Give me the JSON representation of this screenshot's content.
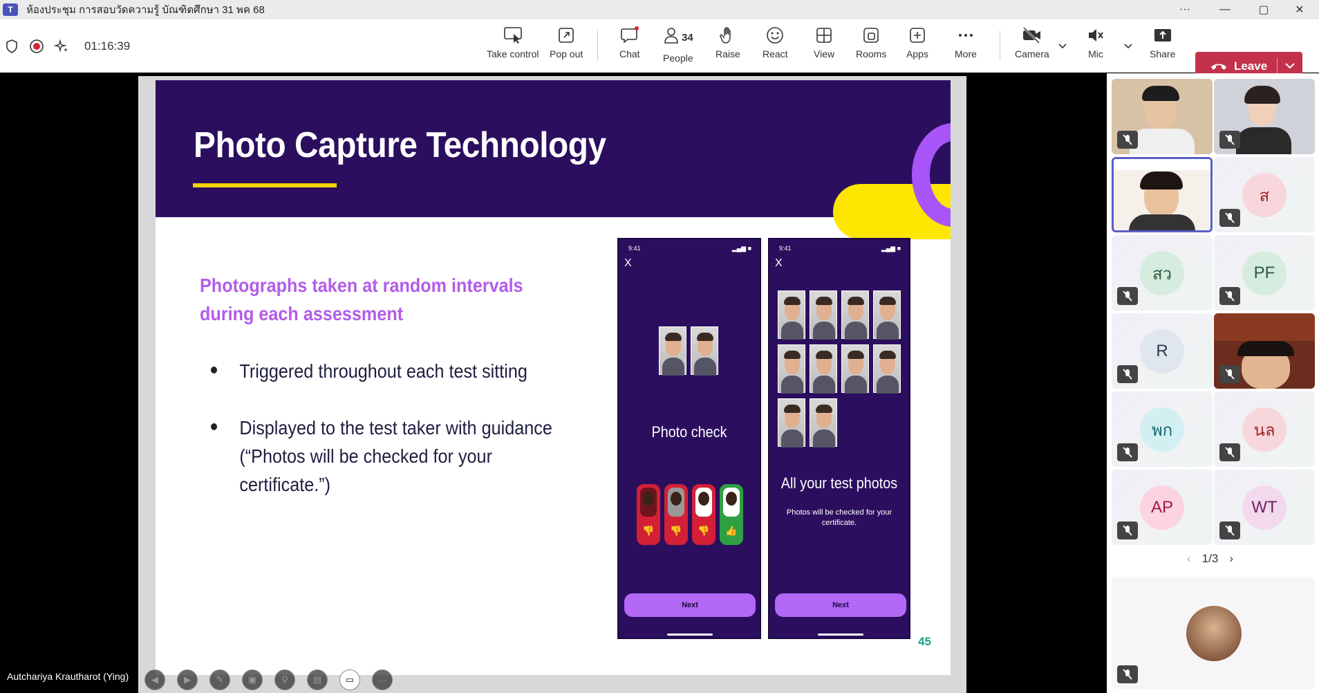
{
  "window": {
    "title": "ห้องประชุม การสอบวัดความรู้ บัณฑิตศึกษา 31 พค 68",
    "minimize": "—",
    "maximize": "▢",
    "close": "✕",
    "menu": "···"
  },
  "toolbar": {
    "timer": "01:16:39",
    "take_control": "Take control",
    "pop_out": "Pop out",
    "chat": "Chat",
    "people": "People",
    "people_count": "34",
    "raise": "Raise",
    "react": "React",
    "view": "View",
    "rooms": "Rooms",
    "apps": "Apps",
    "more": "More",
    "camera": "Camera",
    "mic": "Mic",
    "share": "Share",
    "leave": "Leave"
  },
  "colors": {
    "leave": "#c4314b",
    "slide_header": "#2b0f5e",
    "accent_yellow": "#f5d200",
    "subhead": "#b35ce8",
    "page_number": "#1aa38b"
  },
  "slide": {
    "title": "Photo Capture Technology",
    "subheading_line1": "Photographs taken at random intervals",
    "subheading_line2": "during each assessment",
    "bullet1": "Triggered throughout each test sitting",
    "bullet2_line1": "Displayed to the test taker with guidance",
    "bullet2_line2": "(“Photos will be checked for your",
    "bullet2_line3": "certificate.”)",
    "page_number": "45",
    "phone1": {
      "time": "9:41",
      "close": "X",
      "heading": "Photo check",
      "next": "Next"
    },
    "phone2": {
      "time": "9:41",
      "close": "X",
      "heading": "All your test photos",
      "note_line1": "Photos will be checked for your",
      "note_line2": "certificate.",
      "next": "Next"
    }
  },
  "presenter": "Autchariya Krautharot (Ying)",
  "gallery": {
    "participants": [
      "ส",
      "สว",
      "PF",
      "R",
      "พก",
      "นล",
      "AP",
      "WT"
    ],
    "page_indicator": "1/3"
  }
}
